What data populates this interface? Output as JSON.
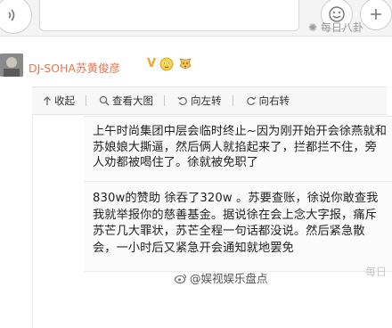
{
  "top_bar": {
    "watermark_text": "每日八卦"
  },
  "post": {
    "author_name": "DJ-SOHA苏黄俊彦",
    "verified_badge": "V",
    "badge_icons": [
      "cat-emoji-icon",
      "dog-emoji-icon"
    ]
  },
  "toolbar": {
    "items": [
      {
        "label": "收起",
        "icon": "arrow-up-icon"
      },
      {
        "label": "查看大图",
        "icon": "magnify-icon"
      },
      {
        "label": "向左转",
        "icon": "rotate-left-icon"
      },
      {
        "label": "向右转",
        "icon": "rotate-right-icon"
      }
    ]
  },
  "image_text": {
    "paragraph1": "上午时尚集团中层会临时终止~因为刚开始开会徐燕就和苏娘娘大撕逼，然后俩人就掐起来了，拦都拦不住，旁人劝都被喝住了。徐就被免职了",
    "paragraph2": "830w的赞助 徐吞了320w 。苏要查账，徐说你敢查我我就举报你的慈善基金。据说徐在会上念大字报，痛斥苏芒几大罪状，苏芒全程一句话都没说。然后紧急散会，一小时后又紧急开会通知就地罢免"
  },
  "watermarks": {
    "bottom_center": "@娱视娱乐盘点",
    "right_edge": "每日"
  },
  "colors": {
    "author_name": "#eb7350",
    "badge": "#f5a623"
  }
}
